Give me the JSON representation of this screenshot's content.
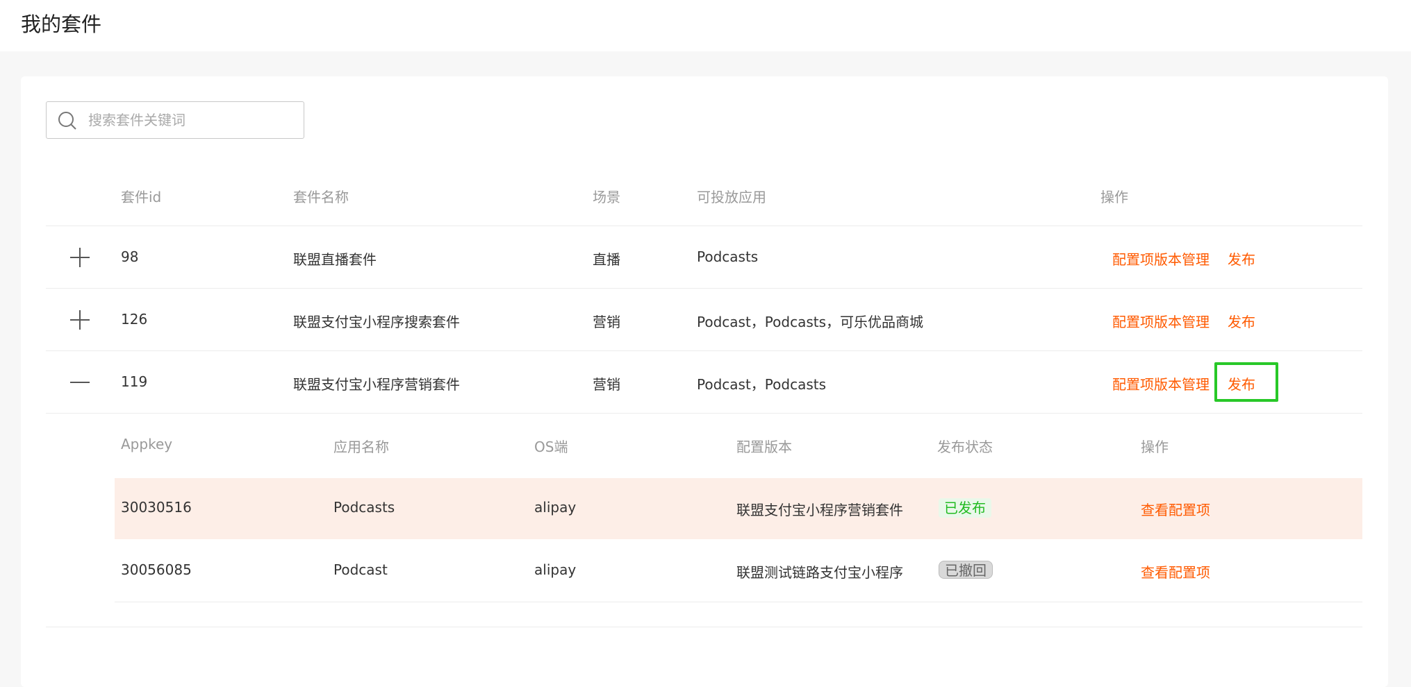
{
  "page": {
    "title": "我的套件"
  },
  "search": {
    "placeholder": "搜索套件关键词",
    "value": ""
  },
  "table": {
    "columns": [
      "套件id",
      "套件名称",
      "场景",
      "可投放应用",
      "操作"
    ],
    "rows": [
      {
        "id": "98",
        "name": "联盟直播套件",
        "scene": "直播",
        "apps": "Podcasts",
        "action_config": "配置项版本管理",
        "action_publish": "发布",
        "expanded": false
      },
      {
        "id": "126",
        "name": "联盟支付宝小程序搜索套件",
        "scene": "营销",
        "apps": "Podcast，Podcasts，可乐优品商城",
        "action_config": "配置项版本管理",
        "action_publish": "发布",
        "expanded": false
      },
      {
        "id": "119",
        "name": "联盟支付宝小程序营销套件",
        "scene": "营销",
        "apps": "Podcast，Podcasts",
        "action_config": "配置项版本管理",
        "action_publish": "发布",
        "expanded": true
      }
    ]
  },
  "subtable": {
    "columns": [
      "Appkey",
      "应用名称",
      "OS端",
      "配置版本",
      "发布状态",
      "操作"
    ],
    "rows": [
      {
        "appkey": "30030516",
        "app_name": "Podcasts",
        "os": "alipay",
        "version": "联盟支付宝小程序营销套件",
        "status": "已发布",
        "action": "查看配置项"
      },
      {
        "appkey": "30056085",
        "app_name": "Podcast",
        "os": "alipay",
        "version": "联盟测试链路支付宝小程序",
        "status": "已撤回",
        "action": "查看配置项"
      }
    ]
  },
  "icons": {
    "search": "search-icon",
    "expand": "plus-icon",
    "collapse": "minus-icon"
  },
  "colors": {
    "accent": "#ff5a00",
    "published": "#22bb22",
    "focus": "#28c828"
  }
}
